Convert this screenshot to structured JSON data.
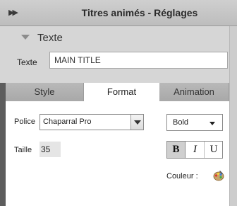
{
  "window": {
    "title": "Titres animés - Réglages"
  },
  "section": {
    "label": "Texte"
  },
  "texte": {
    "label": "Texte",
    "value": "MAIN TITLE"
  },
  "tabs": [
    {
      "label": "Style",
      "active": false
    },
    {
      "label": "Format",
      "active": true
    },
    {
      "label": "Animation",
      "active": false
    }
  ],
  "format": {
    "police_label": "Police",
    "police_value": "Chaparral Pro",
    "style_value": "Bold",
    "taille_label": "Taille",
    "taille_value": "35",
    "bold_label": "B",
    "italic_label": "I",
    "underline_label": "U",
    "bold_active": true,
    "couleur_label": "Couleur :"
  }
}
